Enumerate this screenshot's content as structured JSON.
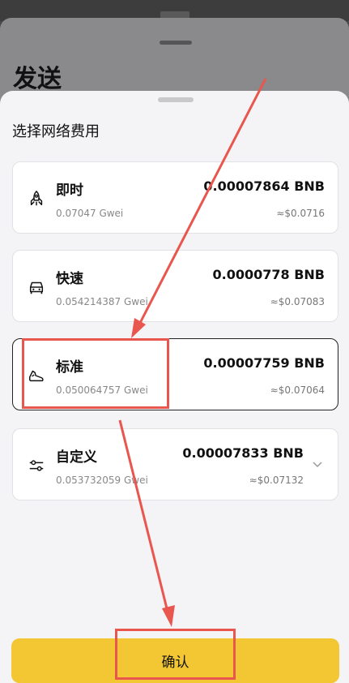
{
  "background_sheet": {
    "title": "发送"
  },
  "sheet": {
    "title": "选择网络费用"
  },
  "fee_options": [
    {
      "name": "即时",
      "gwei": "0.07047 Gwei",
      "amount": "0.00007864 BNB",
      "usd": "≈$0.0716",
      "icon": "rocket-icon"
    },
    {
      "name": "快速",
      "gwei": "0.054214387 Gwei",
      "amount": "0.0000778 BNB",
      "usd": "≈$0.07083",
      "icon": "car-icon"
    },
    {
      "name": "标准",
      "gwei": "0.050064757 Gwei",
      "amount": "0.00007759 BNB",
      "usd": "≈$0.07064",
      "icon": "shoe-icon",
      "selected": true
    },
    {
      "name": "自定义",
      "gwei": "0.053732059 Gwei",
      "amount": "0.00007833 BNB",
      "usd": "≈$0.07132",
      "icon": "sliders-icon",
      "expandable": true
    }
  ],
  "confirm_button": {
    "label": "确认"
  },
  "colors": {
    "accent": "#f3c633",
    "annotation": "#e8564e",
    "selected_border": "#222222"
  }
}
